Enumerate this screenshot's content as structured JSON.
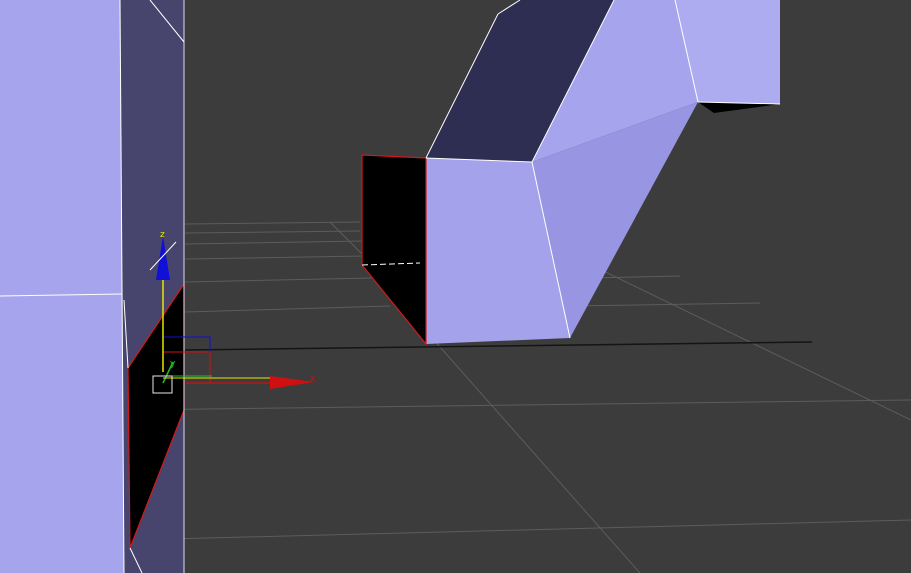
{
  "viewport": {
    "background": "#3c3c3c",
    "grid_color": "#5a5a5a",
    "horizon_color": "#1a1a1a"
  },
  "palette": {
    "face_light": "#a8a6ee",
    "face_mid": "#9d9be6",
    "face_dark": "#2e2d52",
    "face_side": "#47456e",
    "hole": "#000000",
    "selected_edge": "#d01a1a",
    "wire_edge": "#ffffff"
  },
  "gizmo": {
    "x_label": "x",
    "y_label": "y",
    "z_label": "z",
    "x_color": "#d01010",
    "y_color": "#20c020",
    "z_color": "#1010d8",
    "highlight_color": "#e6e600"
  }
}
